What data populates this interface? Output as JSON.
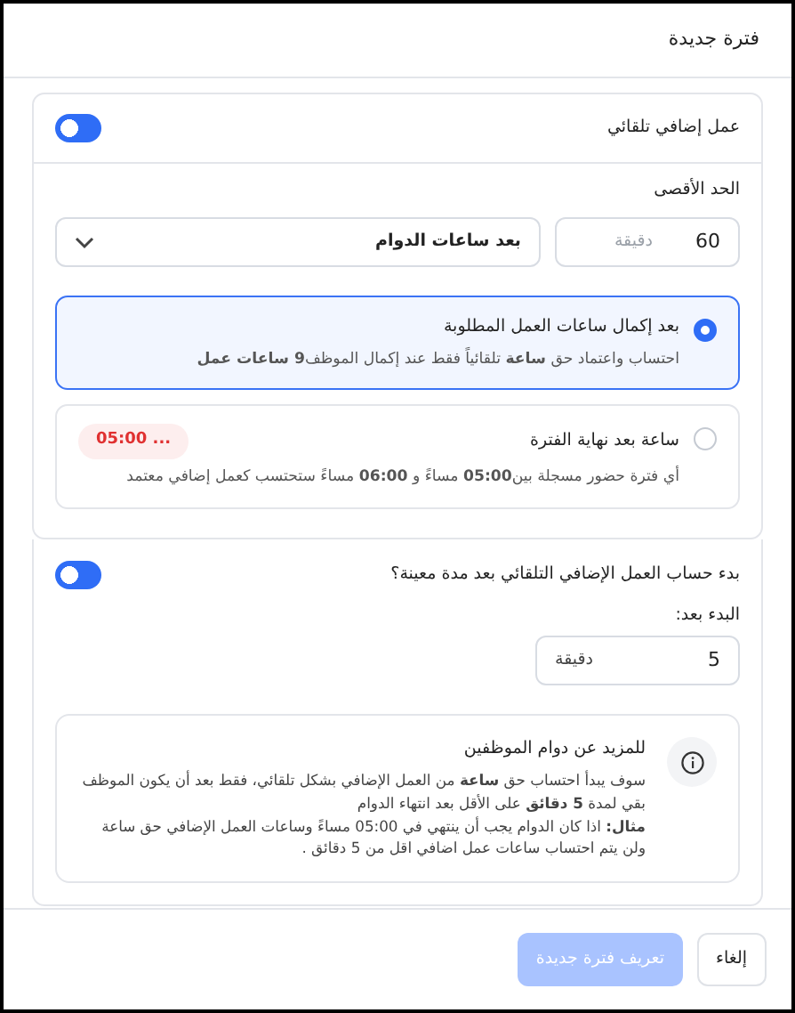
{
  "dialog": {
    "title": "فترة جديدة"
  },
  "auto_overtime": {
    "label": "عمل إضافي تلقائي",
    "on": true,
    "max_label": "الحد الأقصى",
    "max_value": "60",
    "max_unit": "دقيقة",
    "basis_select": "بعد ساعات الدوام",
    "options": [
      {
        "title": "بعد إكمال ساعات العمل المطلوبة",
        "description": "احتساب واعتماد حق **ساعة** تلقائياً فقط عند إكمال الموظف**9 ساعات عمل**",
        "selected": true
      },
      {
        "title": "ساعة بعد نهاية الفترة",
        "badge": "05:00 ...",
        "description": "أي فترة حضور مسجلة بين**05:00** مساءً و **06:00** مساءً ستحتسب كعمل إضافي معتمد",
        "selected": false
      }
    ]
  },
  "delayed_start": {
    "label": "بدء حساب العمل الإضافي التلقائي بعد مدة معينة؟",
    "on": true,
    "start_label": "البدء بعد:",
    "start_value": "5",
    "start_unit": "دقيقة",
    "info": {
      "title": "للمزيد عن دوام الموظفين",
      "paragraphs": [
        "سوف يبدأ احتساب حق **ساعة** من العمل الإضافي بشكل تلقائي، فقط بعد أن يكون الموظف بقي لمدة **5 دقائق** على الأقل بعد انتهاء الدوام",
        "**مثال:** اذا كان الدوام يجب أن ينتهي في 05:00 مساءً وساعات العمل الإضافي حق ساعة ولن يتم احتساب ساعات عمل اضافي اقل من 5 دقائق ."
      ]
    }
  },
  "buttons": [
    {
      "label": "إلغاء",
      "kind": "secondary",
      "disabled": false
    },
    {
      "label": "تعريف فترة جديدة",
      "kind": "primary",
      "disabled": true
    }
  ]
}
